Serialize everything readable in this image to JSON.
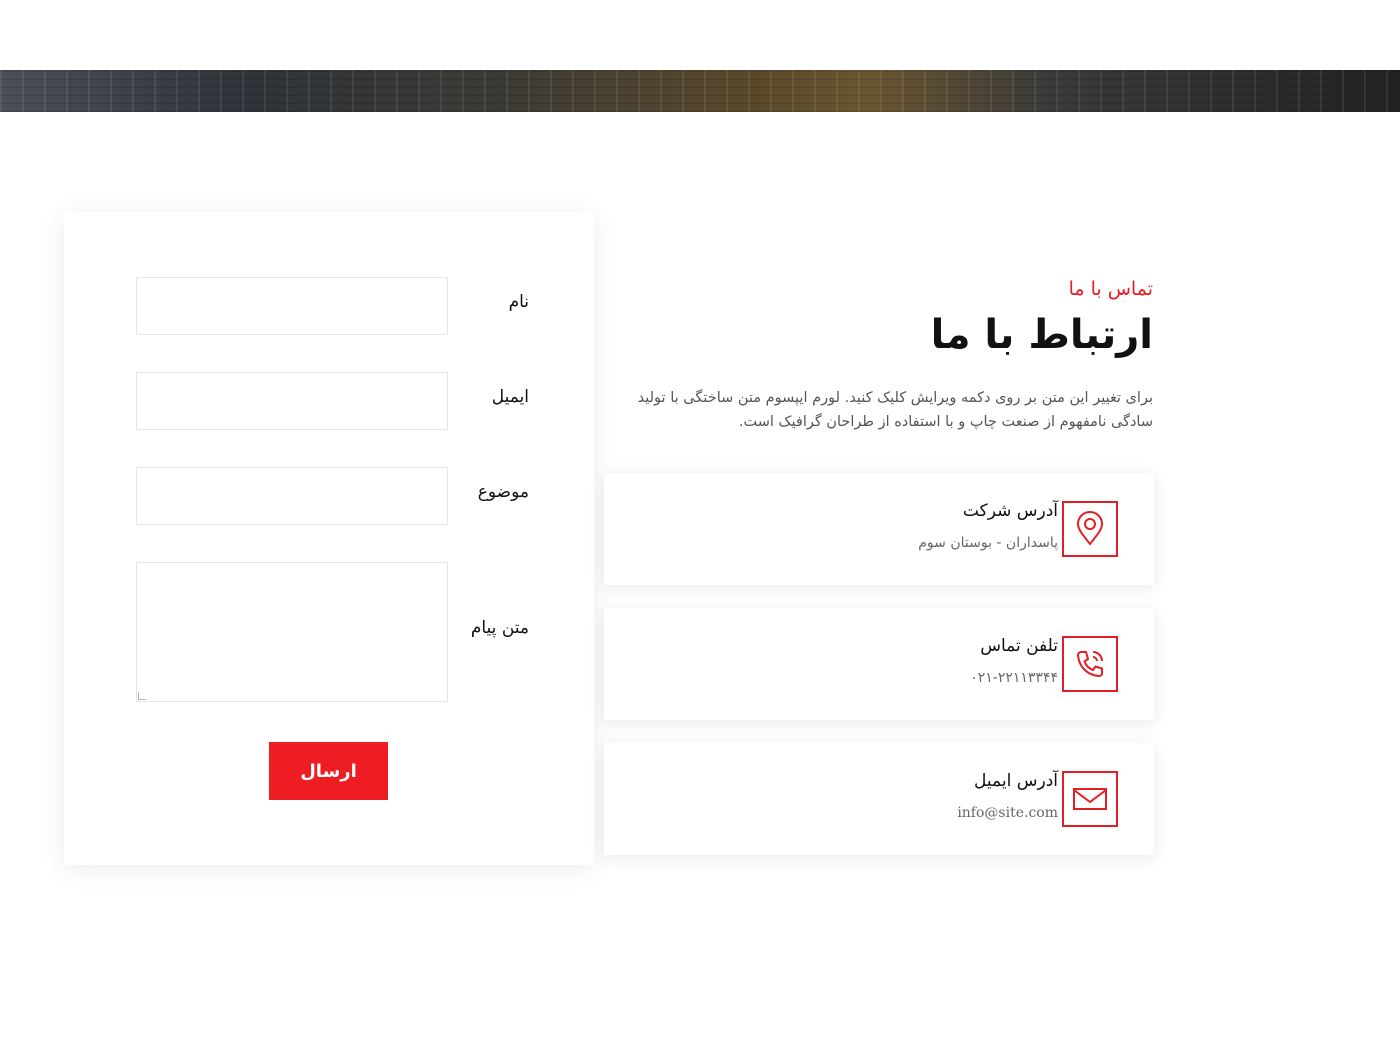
{
  "form": {
    "fields": [
      {
        "label": "نام",
        "value": ""
      },
      {
        "label": "ایمیل",
        "value": ""
      },
      {
        "label": "موضوع",
        "value": ""
      },
      {
        "label": "متن پیام",
        "value": ""
      }
    ],
    "submit_label": "ارسال"
  },
  "contact": {
    "subtitle": "تماس با ما",
    "title": "ارتباط با ما",
    "description": "برای تغییر این متن بر روی دکمه ویرایش کلیک کنید. لورم ایپسوم متن ساختگی با تولید سادگی نامفهوم از صنعت چاپ و با استفاده از طراحان گرافیک است.",
    "cards": [
      {
        "title": "آدرس شرکت",
        "value": "پاسداران - بوستان سوم",
        "icon": "location-pin-icon"
      },
      {
        "title": "تلفن تماس",
        "value": "۰۲۱-۲۲۱۱۳۳۴۴",
        "icon": "phone-icon"
      },
      {
        "title": "آدرس ایمیل",
        "value": "info@site.com",
        "icon": "mail-icon"
      }
    ]
  },
  "colors": {
    "accent": "#e31e24",
    "button": "#ee1c23"
  }
}
